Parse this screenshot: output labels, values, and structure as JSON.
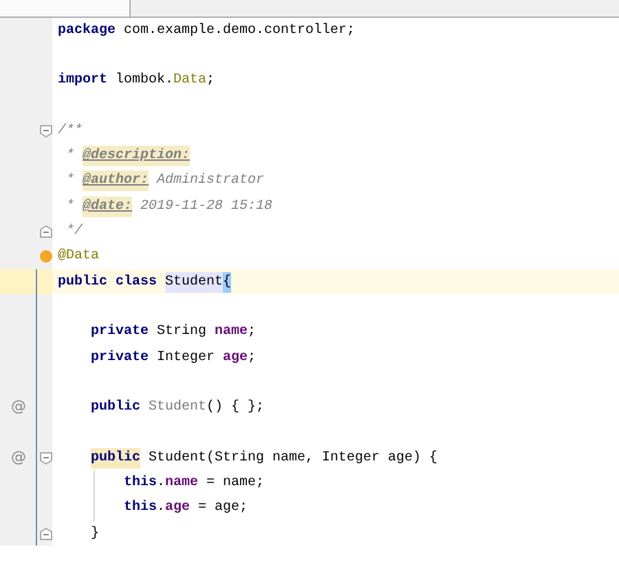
{
  "editor": {
    "lines": [
      {
        "current": false,
        "changed": false,
        "tokens": [
          {
            "kind": "keyword",
            "text": "package"
          },
          {
            "kind": "text",
            "text": " com.example.demo.controller;"
          }
        ]
      },
      {
        "current": false,
        "changed": false
      },
      {
        "current": false,
        "changed": false,
        "tokens": [
          {
            "kind": "keyword",
            "text": "import"
          },
          {
            "kind": "text",
            "text": " lombok."
          },
          {
            "kind": "annotation",
            "text": "Data"
          },
          {
            "kind": "text",
            "text": ";"
          }
        ]
      },
      {
        "current": false,
        "changed": false
      },
      {
        "current": false,
        "changed": false,
        "fold_open": true,
        "tokens": [
          {
            "kind": "comment",
            "text": "/**"
          }
        ]
      },
      {
        "current": false,
        "changed": false,
        "tokens": [
          {
            "kind": "comment",
            "text": " * "
          },
          {
            "kind": "doctag",
            "text": "@description:"
          }
        ]
      },
      {
        "current": false,
        "changed": false,
        "tokens": [
          {
            "kind": "comment",
            "text": " * "
          },
          {
            "kind": "doctag",
            "text": "@author:"
          },
          {
            "kind": "comment",
            "text": " Administrator"
          }
        ]
      },
      {
        "current": false,
        "changed": false,
        "tokens": [
          {
            "kind": "comment",
            "text": " * "
          },
          {
            "kind": "doctag",
            "text": "@date:"
          },
          {
            "kind": "comment",
            "text": " 2019-11-28 15:18"
          }
        ]
      },
      {
        "current": false,
        "changed": false,
        "fold_close": true,
        "tokens": [
          {
            "kind": "comment",
            "text": " */"
          }
        ]
      },
      {
        "current": false,
        "changed": false,
        "bulb": true,
        "tokens": [
          {
            "kind": "annotation",
            "text": "@Data"
          }
        ]
      },
      {
        "current": true,
        "changed": true,
        "tokens": [
          {
            "kind": "keyword",
            "text": "public class "
          },
          {
            "kind": "highlight",
            "text": "Student"
          },
          {
            "kind": "brace",
            "text": "{"
          }
        ]
      },
      {
        "current": false,
        "changed": true
      },
      {
        "current": false,
        "changed": true,
        "in_class": true,
        "tokens": [
          {
            "kind": "keyword",
            "text": "private"
          },
          {
            "kind": "text",
            "text": " String "
          },
          {
            "kind": "field",
            "text": "name"
          },
          {
            "kind": "text",
            "text": ";"
          }
        ]
      },
      {
        "current": false,
        "changed": true,
        "in_class": true,
        "tokens": [
          {
            "kind": "keyword",
            "text": "private"
          },
          {
            "kind": "text",
            "text": " Integer "
          },
          {
            "kind": "field",
            "text": "age"
          },
          {
            "kind": "text",
            "text": ";"
          }
        ]
      },
      {
        "current": false,
        "changed": true
      },
      {
        "current": false,
        "changed": true,
        "gutter_mark": "@",
        "in_class": true,
        "tokens": [
          {
            "kind": "keyword",
            "text": "public "
          },
          {
            "kind": "muted",
            "text": "Student"
          },
          {
            "kind": "text",
            "text": "() { };"
          }
        ]
      },
      {
        "current": false,
        "changed": true
      },
      {
        "current": false,
        "changed": true,
        "gutter_mark": "@",
        "fold_open": true,
        "in_class": true,
        "tokens": [
          {
            "kind": "warning",
            "text": "public"
          },
          {
            "kind": "text",
            "text": " Student(String name, Integer age) {"
          }
        ]
      },
      {
        "current": false,
        "changed": true,
        "in_class": true,
        "in_method": true,
        "tokens": [
          {
            "kind": "keyword",
            "text": "this"
          },
          {
            "kind": "text",
            "text": "."
          },
          {
            "kind": "field",
            "text": "name"
          },
          {
            "kind": "text",
            "text": " = name;"
          }
        ]
      },
      {
        "current": false,
        "changed": true,
        "in_class": true,
        "in_method": true,
        "tokens": [
          {
            "kind": "keyword",
            "text": "this"
          },
          {
            "kind": "text",
            "text": "."
          },
          {
            "kind": "field",
            "text": "age"
          },
          {
            "kind": "text",
            "text": " = age;"
          }
        ]
      },
      {
        "current": false,
        "changed": true,
        "fold_close": true,
        "in_class": true,
        "tokens": [
          {
            "kind": "text",
            "text": "}"
          }
        ]
      }
    ]
  }
}
